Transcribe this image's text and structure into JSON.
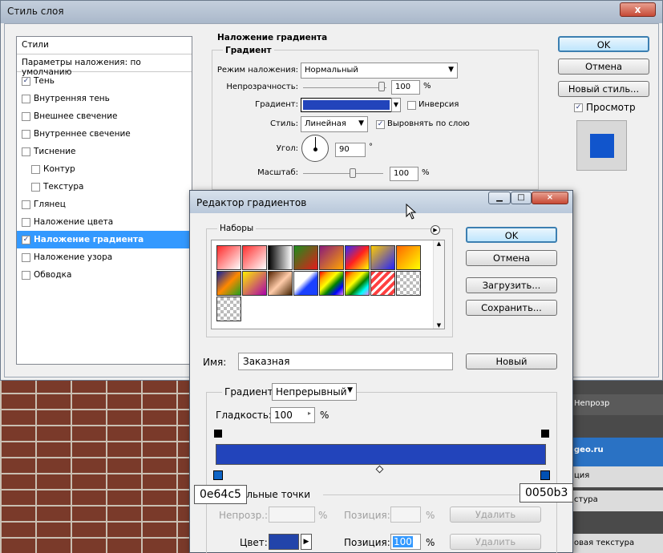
{
  "layer_style": {
    "title": "Стиль слоя",
    "close_glyph": "x",
    "list": {
      "header": "Стили",
      "blending": "Параметры наложения: по умолчанию",
      "items": [
        {
          "label": "Тень",
          "checked": true,
          "sub": false
        },
        {
          "label": "Внутренняя тень",
          "checked": false,
          "sub": false
        },
        {
          "label": "Внешнее свечение",
          "checked": false,
          "sub": false
        },
        {
          "label": "Внутреннее свечение",
          "checked": false,
          "sub": false
        },
        {
          "label": "Тиснение",
          "checked": false,
          "sub": false
        },
        {
          "label": "Контур",
          "checked": false,
          "sub": true
        },
        {
          "label": "Текстура",
          "checked": false,
          "sub": true
        },
        {
          "label": "Глянец",
          "checked": false,
          "sub": false
        },
        {
          "label": "Наложение цвета",
          "checked": false,
          "sub": false
        },
        {
          "label": "Наложение градиента",
          "checked": true,
          "sub": false,
          "selected": true
        },
        {
          "label": "Наложение узора",
          "checked": false,
          "sub": false
        },
        {
          "label": "Обводка",
          "checked": false,
          "sub": false
        }
      ]
    },
    "overlay": {
      "section_title": "Наложение градиента",
      "group_title": "Градиент",
      "blend_mode_label": "Режим наложения:",
      "blend_mode_value": "Нормальный",
      "opacity_label": "Непрозрачность:",
      "opacity_value": "100",
      "opacity_unit": "%",
      "gradient_label": "Градиент:",
      "reverse_label": "Инверсия",
      "style_label": "Стиль:",
      "style_value": "Линейная",
      "align_label": "Выровнять по слою",
      "angle_label": "Угол:",
      "angle_value": "90",
      "angle_unit": "°",
      "scale_label": "Масштаб:",
      "scale_value": "100",
      "scale_unit": "%"
    },
    "buttons": {
      "ok": "OK",
      "cancel": "Отмена",
      "new_style": "Новый стиль...",
      "preview": "Просмотр"
    }
  },
  "gradient_editor": {
    "title": "Редактор градиентов",
    "presets_label": "Наборы",
    "name_label": "Имя:",
    "name_value": "Заказная",
    "new_button": "Новый",
    "ok": "OK",
    "cancel": "Отмена",
    "load": "Загрузить...",
    "save": "Сохранить...",
    "gradient_type_label": "Градиент:",
    "gradient_type_value": "Непрерывный",
    "smoothness_label": "Гладкость:",
    "smoothness_value": "100",
    "smoothness_unit": "%",
    "stops_group_label": "ольные точки",
    "opacity_label": "Непрозр.:",
    "opacity_unit": "%",
    "opacity_position_label": "Позиция:",
    "opacity_position_unit": "%",
    "delete_1": "Удалить",
    "color_label": "Цвет:",
    "color_position_label": "Позиция:",
    "color_position_value": "100",
    "color_position_unit": "%",
    "delete_2": "Удалить"
  },
  "callouts": {
    "left": "0e64c5",
    "right": "0050b3"
  },
  "background": {
    "rows": [
      "Непрозр",
      "geo.ru",
      "ция",
      "стура",
      "овая текстура"
    ]
  },
  "colors": {
    "gradient_start": "#0e64c5",
    "gradient_end": "#0050b3",
    "gradient_bar": "#2244bb",
    "selection": "#3399ff",
    "preview_swatch": "#1155cc"
  }
}
